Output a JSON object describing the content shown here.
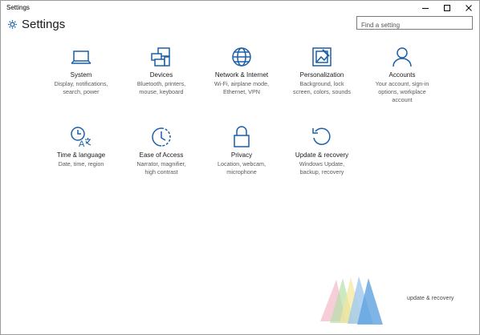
{
  "window": {
    "title": "Settings"
  },
  "header": {
    "title": "Settings",
    "search_placeholder": "Find a setting"
  },
  "tiles": [
    {
      "name": "System",
      "desc": [
        "Display, notifications,",
        "search, power"
      ],
      "icon": "laptop-icon"
    },
    {
      "name": "Devices",
      "desc": [
        "Bluetooth, printers,",
        "mouse, keyboard"
      ],
      "icon": "devices-icon"
    },
    {
      "name": "Network & Internet",
      "desc": [
        "Wi-Fi, airplane mode,",
        "Ethernet, VPN"
      ],
      "icon": "globe-icon"
    },
    {
      "name": "Personalization",
      "desc": [
        "Background, lock",
        "screen, colors, sounds"
      ],
      "icon": "personalization-icon"
    },
    {
      "name": "Accounts",
      "desc": [
        "Your account, sign-in",
        "options, workplace",
        "account"
      ],
      "icon": "person-icon"
    },
    {
      "name": "Time & language",
      "desc": [
        "Date, time, region"
      ],
      "icon": "time-language-icon"
    },
    {
      "name": "Ease of Access",
      "desc": [
        "Narrator, magnifier,",
        "high contrast"
      ],
      "icon": "ease-of-access-icon"
    },
    {
      "name": "Privacy",
      "desc": [
        "Location, webcam,",
        "microphone"
      ],
      "icon": "lock-icon"
    },
    {
      "name": "Update & recovery",
      "desc": [
        "Windows Update,",
        "backup, recovery"
      ],
      "icon": "refresh-icon"
    }
  ],
  "watermark": {
    "text": "update & recovery"
  },
  "colors": {
    "accent": "#1a5fa8",
    "text": "#1a1a1a",
    "subtext": "#5a5a5a"
  }
}
